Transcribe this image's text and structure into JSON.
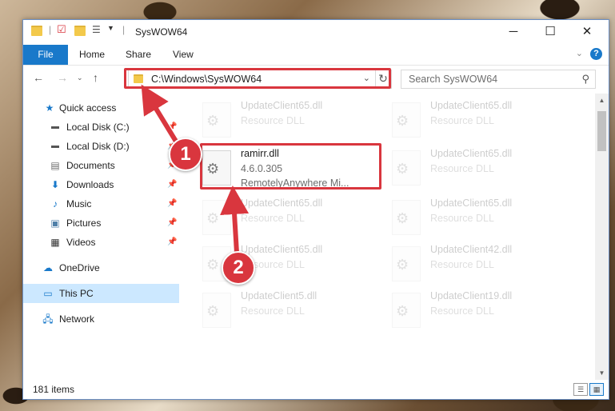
{
  "window": {
    "title": "SysWOW64",
    "controls": {
      "minimize": "─",
      "maximize": "☐",
      "close": "✕"
    }
  },
  "ribbon": {
    "tabs": [
      "File",
      "Home",
      "Share",
      "View"
    ]
  },
  "nav": {
    "address": "C:\\Windows\\SysWOW64",
    "search_placeholder": "Search SysWOW64"
  },
  "sidebar": {
    "items": [
      {
        "label": "Quick access",
        "icon": "star-icon"
      },
      {
        "label": "Local Disk (C:)",
        "icon": "drive-icon"
      },
      {
        "label": "Local Disk (D:)",
        "icon": "drive-icon"
      },
      {
        "label": "Documents",
        "icon": "documents-icon"
      },
      {
        "label": "Downloads",
        "icon": "download-icon"
      },
      {
        "label": "Music",
        "icon": "music-icon"
      },
      {
        "label": "Pictures",
        "icon": "pictures-icon"
      },
      {
        "label": "Videos",
        "icon": "videos-icon"
      },
      {
        "label": "OneDrive",
        "icon": "cloud-icon"
      },
      {
        "label": "This PC",
        "icon": "computer-icon"
      },
      {
        "label": "Network",
        "icon": "network-icon"
      }
    ]
  },
  "files": [
    {
      "name": "UpdateClient65.dll",
      "sub": "Resource DLL"
    },
    {
      "name": "UpdateClient65.dll",
      "sub": "Resource DLL"
    },
    {
      "name": "ramirr.dll",
      "version": "4.6.0.305",
      "sub": "RemotelyAnywhere Mi..."
    },
    {
      "name": "UpdateClient65.dll",
      "sub": "Resource DLL"
    },
    {
      "name": "UpdateClient65.dll",
      "sub": "Resource DLL"
    },
    {
      "name": "UpdateClient65.dll",
      "sub": "Resource DLL"
    },
    {
      "name": "UpdateClient65.dll",
      "sub": "Resource DLL"
    },
    {
      "name": "UpdateClient42.dll",
      "sub": "Resource DLL"
    },
    {
      "name": "UpdateClient5.dll",
      "sub": "Resource DLL"
    },
    {
      "name": "UpdateClient19.dll",
      "sub": "Resource DLL"
    }
  ],
  "status": {
    "count": "181 items"
  },
  "callouts": [
    "1",
    "2"
  ],
  "colors": {
    "accent": "#1979ca",
    "highlight": "#d9363e",
    "selected": "#cce8ff"
  }
}
